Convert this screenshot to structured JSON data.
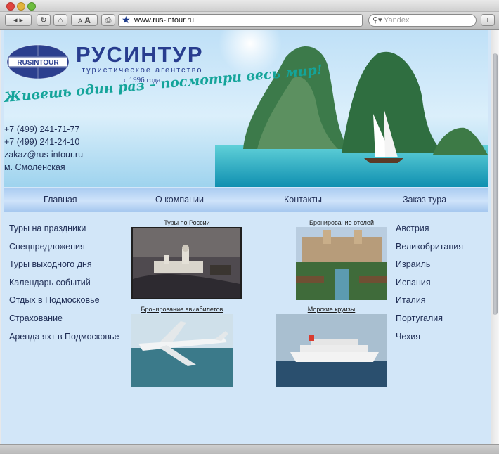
{
  "browser": {
    "url": "www.rus-intour.ru",
    "search_placeholder": "Yandex",
    "back_label": "◂ ▸",
    "font_small": "A",
    "font_large": "A",
    "add_tab": "+"
  },
  "header": {
    "logo_text": "RUSINTOUR",
    "brand": "РУСИНТУР",
    "tagline": "туристическое агентство",
    "since": "с 1996 года",
    "slogan": "Живешь один раз – посмотри весь мир!",
    "phone1": "+7 (499) 241-71-77",
    "phone2": "+7 (499) 241-24-10",
    "email": "zakaz@rus-intour.ru",
    "metro": "м. Смоленская"
  },
  "nav": [
    "Главная",
    "О компании",
    "Контакты",
    "Заказ тура"
  ],
  "left_menu": [
    "Туры на праздники",
    "Спецпредложения",
    "Туры выходного дня",
    "Календарь событий",
    "Отдых в Подмосковье",
    "Страхование",
    "Аренда яхт в Подмосковье"
  ],
  "tiles": [
    "Туры по России",
    "Бронирование отелей",
    "Бронирование авиабилетов",
    "Морские круизы"
  ],
  "right_menu": [
    "Австрия",
    "Великобритания",
    "Израиль",
    "Испания",
    "Италия",
    "Португалия",
    "Чехия"
  ]
}
